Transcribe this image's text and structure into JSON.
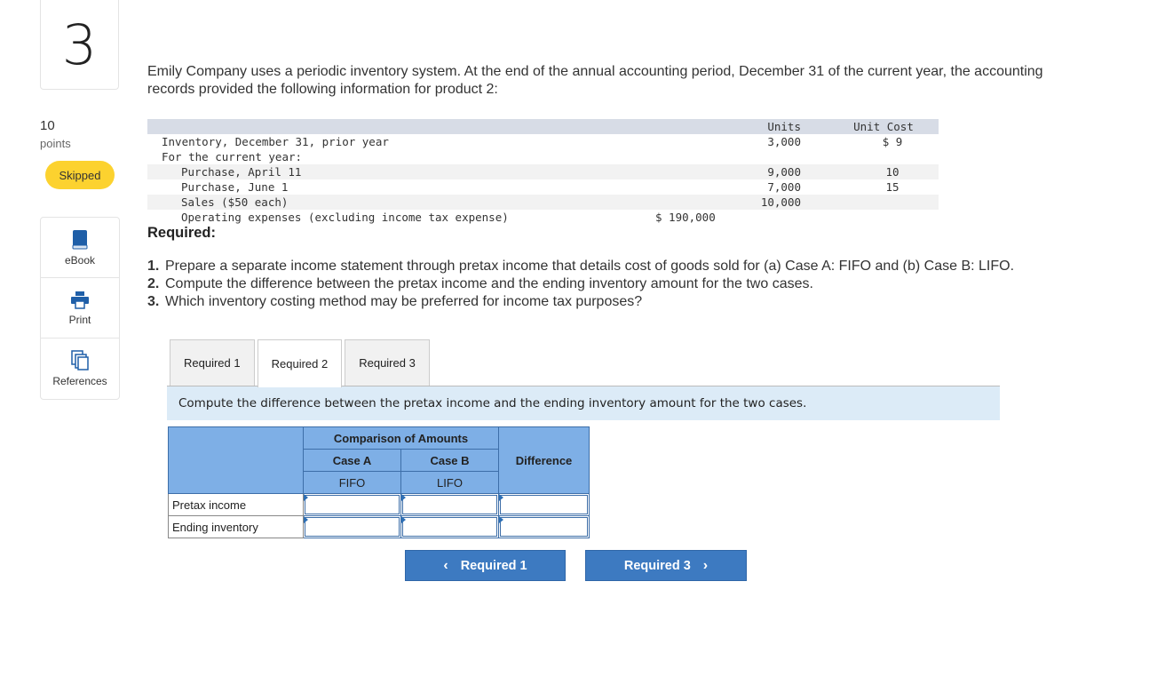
{
  "question": {
    "number": "3",
    "points_value": "10",
    "points_label": "points",
    "status": "Skipped"
  },
  "tools": [
    {
      "label": "eBook",
      "icon": "book-icon"
    },
    {
      "label": "Print",
      "icon": "printer-icon"
    },
    {
      "label": "References",
      "icon": "references-icon"
    }
  ],
  "intro": "Emily Company uses a periodic inventory system. At the end of the annual accounting period, December 31 of the current year, the accounting records provided the following information for product 2:",
  "data_table": {
    "col_units": "Units",
    "col_unit_cost": "Unit Cost",
    "rows": [
      {
        "label": "Inventory, December 31, prior year",
        "amount": "",
        "units": "3,000",
        "cost": "$ 9"
      },
      {
        "label": "For the current year:",
        "amount": "",
        "units": "",
        "cost": ""
      },
      {
        "label": "Purchase, April 11",
        "amount": "",
        "units": "9,000",
        "cost": "10"
      },
      {
        "label": "Purchase, June 1",
        "amount": "",
        "units": "7,000",
        "cost": "15"
      },
      {
        "label": "Sales ($50 each)",
        "amount": "",
        "units": "10,000",
        "cost": ""
      },
      {
        "label": "Operating expenses (excluding income tax expense)",
        "amount": "$ 190,000",
        "units": "",
        "cost": ""
      }
    ]
  },
  "required_heading": "Required:",
  "requirements": [
    {
      "num": "1.",
      "text": "Prepare a separate income statement through pretax income that details cost of goods sold for (a) Case A: FIFO and (b) Case B: LIFO."
    },
    {
      "num": "2.",
      "text": "Compute the difference between the pretax income and the ending inventory amount for the two cases."
    },
    {
      "num": "3.",
      "text": "Which inventory costing method may be preferred for income tax purposes?"
    }
  ],
  "tabs": [
    "Required 1",
    "Required 2",
    "Required 3"
  ],
  "active_tab": "Required 2",
  "instruction": "Compute the difference between the pretax income and the ending inventory amount for the two cases.",
  "answer_table": {
    "group_header": "Comparison of Amounts",
    "case_a": "Case A",
    "case_a_method": "FIFO",
    "case_b": "Case B",
    "case_b_method": "LIFO",
    "difference": "Difference",
    "rows": [
      {
        "label": "Pretax income",
        "case_a": "",
        "case_b": "",
        "difference": ""
      },
      {
        "label": "Ending inventory",
        "case_a": "",
        "case_b": "",
        "difference": ""
      }
    ]
  },
  "nav": {
    "prev_label": "Required 1",
    "next_label": "Required 3",
    "prev_icon": "chevron-left-icon",
    "next_icon": "chevron-right-icon"
  }
}
